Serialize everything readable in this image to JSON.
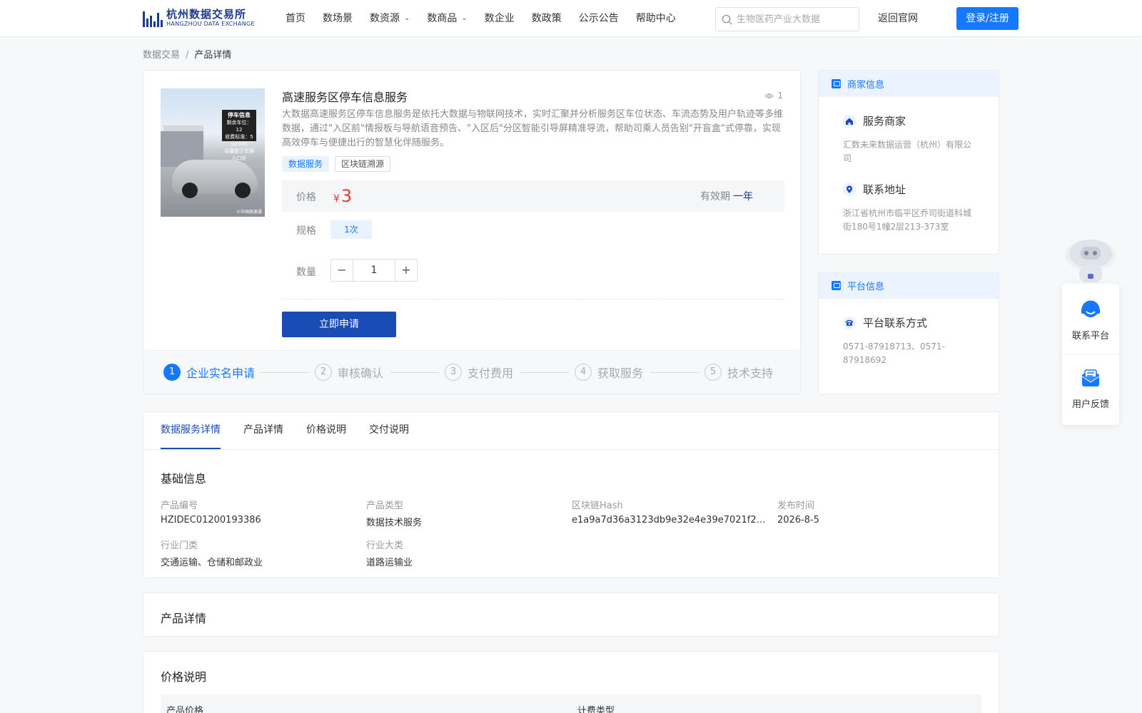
{
  "header": {
    "logo_cn": "杭州数据交易所",
    "logo_en": "HANGZHOU DATA EXCHANGE",
    "nav": [
      {
        "label": "首页",
        "dropdown": false
      },
      {
        "label": "数场景",
        "dropdown": false
      },
      {
        "label": "数资源",
        "dropdown": true
      },
      {
        "label": "数商品",
        "dropdown": true
      },
      {
        "label": "数企业",
        "dropdown": false
      },
      {
        "label": "数政策",
        "dropdown": false
      },
      {
        "label": "公示公告",
        "dropdown": false
      },
      {
        "label": "帮助中心",
        "dropdown": false
      }
    ],
    "search_placeholder": "生物医药产业大数据",
    "back_label": "返回官网",
    "login_label": "登录/注册"
  },
  "breadcrumb": {
    "root": "数据交易",
    "separator": "/",
    "current": "产品详情"
  },
  "product": {
    "title": "高速服务区停车信息服务",
    "views": "1",
    "description": "大数据高速服务区停车信息服务是依托大数据与物联网技术，实时汇聚并分析服务区车位状态、车流态势及用户轨迹等多维数据，通过\"入区前\"情报板与导航语音预告、\"入区后\"分区智能引导屏精准导流，帮助司乘人员告别\"开盲盒\"式停靠，实现高效停车与便捷出行的智慧化伴随服务。",
    "tags": [
      "数据服务",
      "区块链溯源"
    ],
    "image_sign_lines": [
      "停车信息",
      "剩余车位：12",
      "收费标准：5元/小时",
      "温馨提示车辆入口处"
    ],
    "image_watermark": "©中国高速通",
    "price_label": "价格",
    "currency": "¥",
    "price": "3",
    "validity_label": "有效期",
    "validity_value": "一年",
    "spec_label": "规格",
    "spec_value": "1次",
    "qty_label": "数量",
    "qty_value": "1",
    "apply_label": "立即申请"
  },
  "steps": [
    {
      "num": "1",
      "label": "企业实名申请",
      "active": true
    },
    {
      "num": "2",
      "label": "审核确认",
      "active": false
    },
    {
      "num": "3",
      "label": "支付费用",
      "active": false
    },
    {
      "num": "4",
      "label": "获取服务",
      "active": false
    },
    {
      "num": "5",
      "label": "技术支持",
      "active": false
    }
  ],
  "merchant": {
    "head": "商家信息",
    "service_title": "服务商家",
    "service_value": "汇数未来数据运营（杭州）有限公司",
    "addr_title": "联系地址",
    "addr_value": "浙江省杭州市临平区乔司街道科城街180号1幢2层213-373室"
  },
  "platform": {
    "head": "平台信息",
    "contact_title": "平台联系方式",
    "contact_value": "0571-87918713、0571-87918692"
  },
  "float_bar": {
    "contact": "联系平台",
    "feedback": "用户反馈"
  },
  "tabs": [
    "数据服务详情",
    "产品详情",
    "价格说明",
    "交付说明"
  ],
  "basic": {
    "title": "基础信息",
    "items": [
      {
        "k": "产品编号",
        "v": "HZIDEC01200193386"
      },
      {
        "k": "产品类型",
        "v": "数据技术服务"
      },
      {
        "k": "区块链Hash",
        "v": "e1a9a7d36a3123db9e32e4e39e7021f237..."
      },
      {
        "k": "发布时间",
        "v": "2026-8-5"
      },
      {
        "k": "行业门类",
        "v": "交通运输、仓储和邮政业"
      },
      {
        "k": "行业大类",
        "v": "道路运输业"
      }
    ]
  },
  "detail": {
    "title": "产品详情"
  },
  "price_section": {
    "title": "价格说明",
    "col1": "产品价格",
    "col2": "计费类型"
  },
  "colors": {
    "primary": "#1677ff",
    "dark_blue": "#1a4cb5",
    "price_red": "#e53935"
  }
}
